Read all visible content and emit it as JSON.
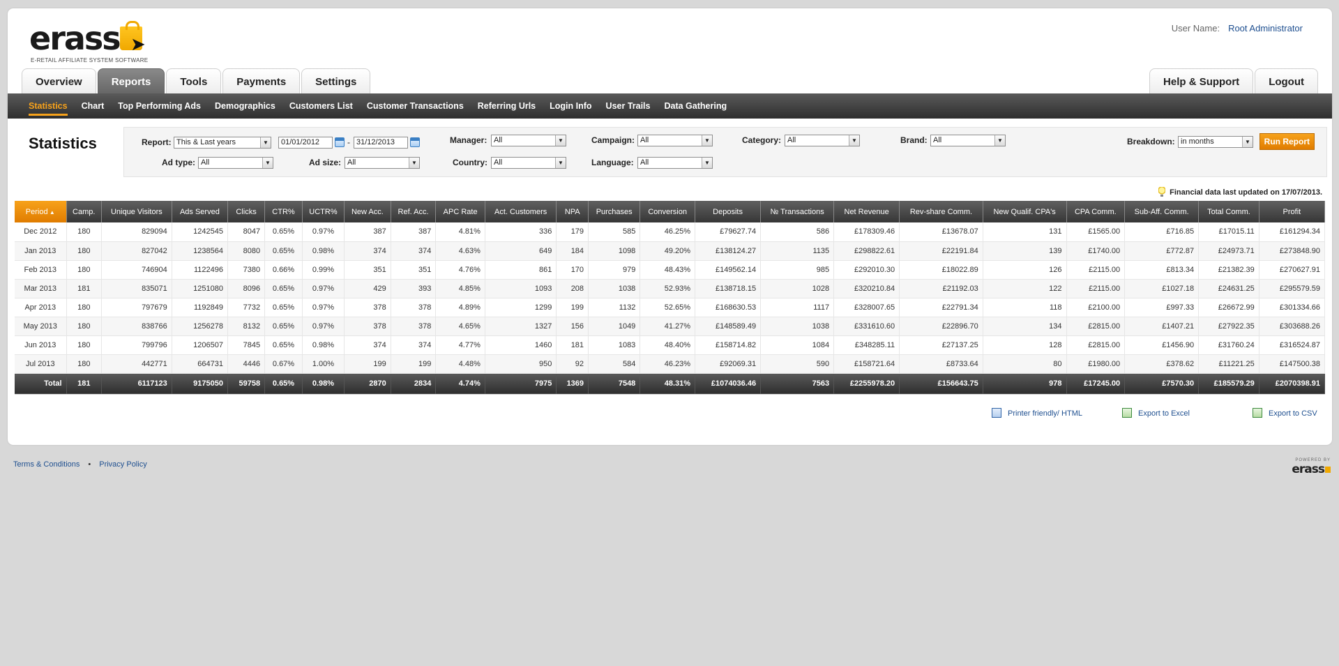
{
  "logo": {
    "word": "erass",
    "tagline": "E-RETAIL AFFILIATE SYSTEM SOFTWARE"
  },
  "user": {
    "label": "User Name:",
    "name": "Root Administrator"
  },
  "main_tabs": [
    "Overview",
    "Reports",
    "Tools",
    "Payments",
    "Settings"
  ],
  "right_tabs": [
    "Help & Support",
    "Logout"
  ],
  "active_tab": "Reports",
  "sub_nav": [
    "Statistics",
    "Chart",
    "Top Performing Ads",
    "Demographics",
    "Customers List",
    "Customer Transactions",
    "Referring Urls",
    "Login Info",
    "User Trails",
    "Data Gathering"
  ],
  "page_title": "Statistics",
  "filters": {
    "report_label": "Report:",
    "report_value": "This & Last years",
    "date_from": "01/01/2012",
    "date_sep": "-",
    "date_to": "31/12/2013",
    "adtype_label": "Ad type:",
    "adtype_value": "All",
    "adsize_label": "Ad size:",
    "adsize_value": "All",
    "manager_label": "Manager:",
    "manager_value": "All",
    "country_label": "Country:",
    "country_value": "All",
    "campaign_label": "Campaign:",
    "campaign_value": "All",
    "language_label": "Language:",
    "language_value": "All",
    "category_label": "Category:",
    "category_value": "All",
    "brand_label": "Brand:",
    "brand_value": "All",
    "breakdown_label": "Breakdown:",
    "breakdown_value": "in months",
    "run_button": "Run Report"
  },
  "financial_note": "Financial data last updated on 17/07/2013.",
  "table": {
    "headers": [
      "Period",
      "Camp.",
      "Unique Visitors",
      "Ads Served",
      "Clicks",
      "CTR%",
      "UCTR%",
      "New Acc.",
      "Ref. Acc.",
      "APC Rate",
      "Act. Customers",
      "NPA",
      "Purchases",
      "Conversion",
      "Deposits",
      "№ Transactions",
      "Net Revenue",
      "Rev-share Comm.",
      "New Qualif. CPA's",
      "CPA Comm.",
      "Sub-Aff. Comm.",
      "Total Comm.",
      "Profit"
    ],
    "rows": [
      [
        "Dec 2012",
        "180",
        "829094",
        "1242545",
        "8047",
        "0.65%",
        "0.97%",
        "387",
        "387",
        "4.81%",
        "336",
        "179",
        "585",
        "46.25%",
        "£79627.74",
        "586",
        "£178309.46",
        "£13678.07",
        "131",
        "£1565.00",
        "£716.85",
        "£17015.11",
        "£161294.34"
      ],
      [
        "Jan 2013",
        "180",
        "827042",
        "1238564",
        "8080",
        "0.65%",
        "0.98%",
        "374",
        "374",
        "4.63%",
        "649",
        "184",
        "1098",
        "49.20%",
        "£138124.27",
        "1135",
        "£298822.61",
        "£22191.84",
        "139",
        "£1740.00",
        "£772.87",
        "£24973.71",
        "£273848.90"
      ],
      [
        "Feb 2013",
        "180",
        "746904",
        "1122496",
        "7380",
        "0.66%",
        "0.99%",
        "351",
        "351",
        "4.76%",
        "861",
        "170",
        "979",
        "48.43%",
        "£149562.14",
        "985",
        "£292010.30",
        "£18022.89",
        "126",
        "£2115.00",
        "£813.34",
        "£21382.39",
        "£270627.91"
      ],
      [
        "Mar 2013",
        "181",
        "835071",
        "1251080",
        "8096",
        "0.65%",
        "0.97%",
        "429",
        "393",
        "4.85%",
        "1093",
        "208",
        "1038",
        "52.93%",
        "£138718.15",
        "1028",
        "£320210.84",
        "£21192.03",
        "122",
        "£2115.00",
        "£1027.18",
        "£24631.25",
        "£295579.59"
      ],
      [
        "Apr 2013",
        "180",
        "797679",
        "1192849",
        "7732",
        "0.65%",
        "0.97%",
        "378",
        "378",
        "4.89%",
        "1299",
        "199",
        "1132",
        "52.65%",
        "£168630.53",
        "1117",
        "£328007.65",
        "£22791.34",
        "118",
        "£2100.00",
        "£997.33",
        "£26672.99",
        "£301334.66"
      ],
      [
        "May 2013",
        "180",
        "838766",
        "1256278",
        "8132",
        "0.65%",
        "0.97%",
        "378",
        "378",
        "4.65%",
        "1327",
        "156",
        "1049",
        "41.27%",
        "£148589.49",
        "1038",
        "£331610.60",
        "£22896.70",
        "134",
        "£2815.00",
        "£1407.21",
        "£27922.35",
        "£303688.26"
      ],
      [
        "Jun 2013",
        "180",
        "799796",
        "1206507",
        "7845",
        "0.65%",
        "0.98%",
        "374",
        "374",
        "4.77%",
        "1460",
        "181",
        "1083",
        "48.40%",
        "£158714.82",
        "1084",
        "£348285.11",
        "£27137.25",
        "128",
        "£2815.00",
        "£1456.90",
        "£31760.24",
        "£316524.87"
      ],
      [
        "Jul 2013",
        "180",
        "442771",
        "664731",
        "4446",
        "0.67%",
        "1.00%",
        "199",
        "199",
        "4.48%",
        "950",
        "92",
        "584",
        "46.23%",
        "£92069.31",
        "590",
        "£158721.64",
        "£8733.64",
        "80",
        "£1980.00",
        "£378.62",
        "£11221.25",
        "£147500.38"
      ]
    ],
    "total": [
      "Total",
      "181",
      "6117123",
      "9175050",
      "59758",
      "0.65%",
      "0.98%",
      "2870",
      "2834",
      "4.74%",
      "7975",
      "1369",
      "7548",
      "48.31%",
      "£1074036.46",
      "7563",
      "£2255978.20",
      "£156643.75",
      "978",
      "£17245.00",
      "£7570.30",
      "£185579.29",
      "£2070398.91"
    ]
  },
  "exports": {
    "html": "Printer friendly/ HTML",
    "excel": "Export to Excel",
    "csv": "Export to CSV"
  },
  "footer": {
    "terms": "Terms & Conditions",
    "dot": "•",
    "privacy": "Privacy Policy",
    "powered_by": "POWERED BY",
    "powered_logo": "erass"
  }
}
